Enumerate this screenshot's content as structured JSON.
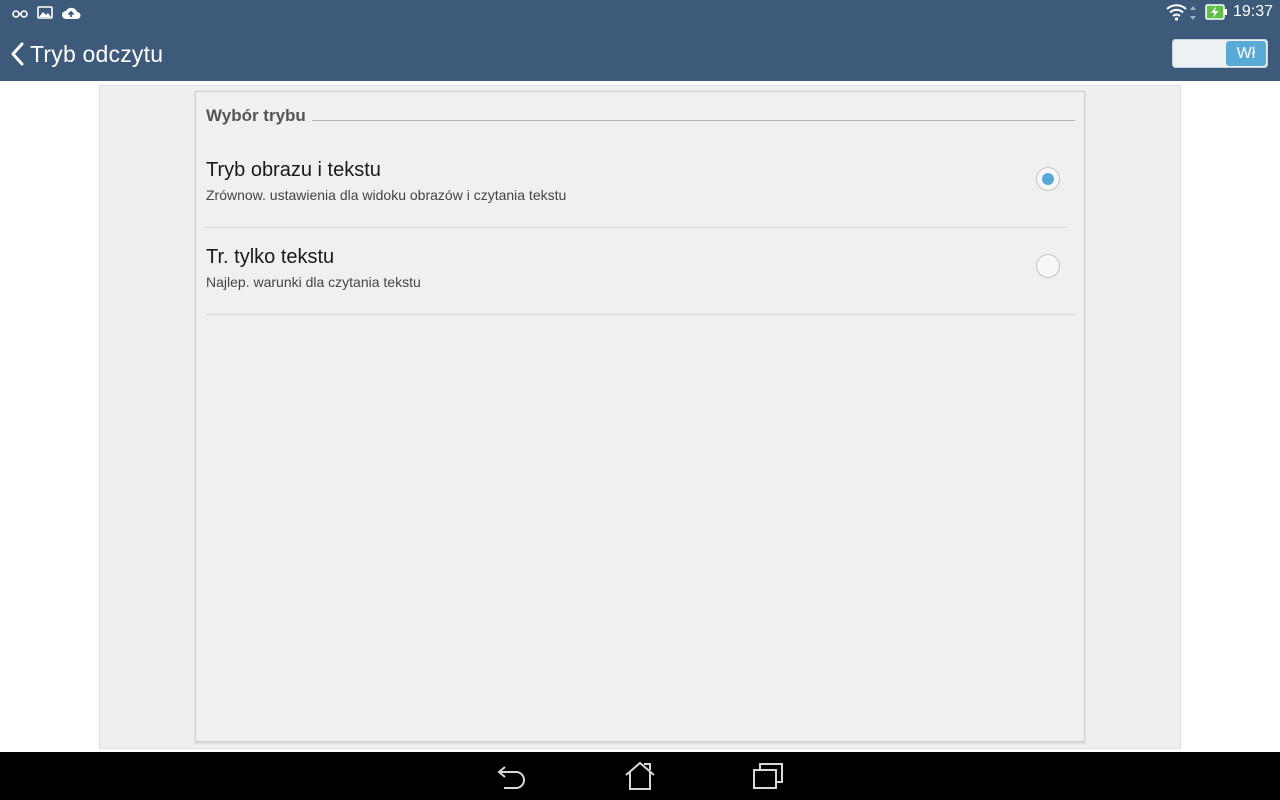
{
  "statusbar": {
    "left_icons": [
      "glasses-icon",
      "image-icon",
      "cloud-upload-icon"
    ],
    "right_icons": [
      "wifi-icon",
      "data-arrows-icon",
      "battery-charging-icon"
    ],
    "time": "19:37"
  },
  "actionbar": {
    "title": "Tryb odczytu",
    "toggle_label": "Wł",
    "toggle_on": true
  },
  "section": {
    "title": "Wybór trybu",
    "options": [
      {
        "title": "Tryb obrazu i tekstu",
        "subtitle": "Zrównow. ustawienia dla widoku obrazów i czytania tekstu",
        "selected": true
      },
      {
        "title": "Tr. tylko tekstu",
        "subtitle": "Najlep. warunki dla czytania tekstu",
        "selected": false
      }
    ]
  },
  "navbar": {
    "buttons": [
      "back-icon",
      "home-icon",
      "recent-apps-icon"
    ]
  },
  "colors": {
    "bar": "#3d5a7a",
    "accent": "#58a8d6",
    "navbar": "#000000"
  }
}
